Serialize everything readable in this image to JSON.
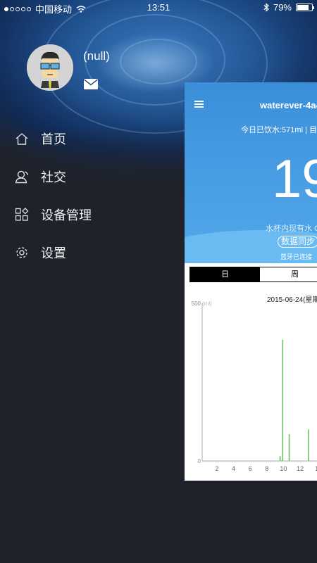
{
  "status_bar": {
    "carrier": "中国移动",
    "time": "13:51",
    "battery": "79%",
    "battery_level": 0.79
  },
  "profile": {
    "username": "(null)"
  },
  "menu": {
    "items": [
      {
        "label": "首页",
        "icon": "home-icon"
      },
      {
        "label": "社交",
        "icon": "social-icon"
      },
      {
        "label": "设备管理",
        "icon": "device-management-icon"
      },
      {
        "label": "设置",
        "icon": "settings-icon"
      }
    ]
  },
  "main": {
    "device_title": "waterever-4a4",
    "today_info": "今日已饮水:571ml | 目",
    "big_number": "19",
    "cup_info": "水杯内现有水 C",
    "sync_button": "数据同步",
    "bluetooth_status": "蓝牙已连接",
    "tabs": [
      "日",
      "周"
    ],
    "active_tab": 0,
    "date_label": "2015-06-24(星期"
  },
  "chart_data": {
    "type": "bar",
    "ylabel": "(ml)",
    "ylim": [
      0,
      500
    ],
    "y_ticks": [
      "0",
      "500"
    ],
    "x_tick_labels": [
      "2",
      "4",
      "6",
      "8",
      "10",
      "12",
      "1"
    ],
    "bars": [
      {
        "x": 9.6,
        "value": 15
      },
      {
        "x": 9.9,
        "value": 385
      },
      {
        "x": 10.7,
        "value": 85
      },
      {
        "x": 13.0,
        "value": 100
      }
    ],
    "bar_color": "#7cc576"
  }
}
